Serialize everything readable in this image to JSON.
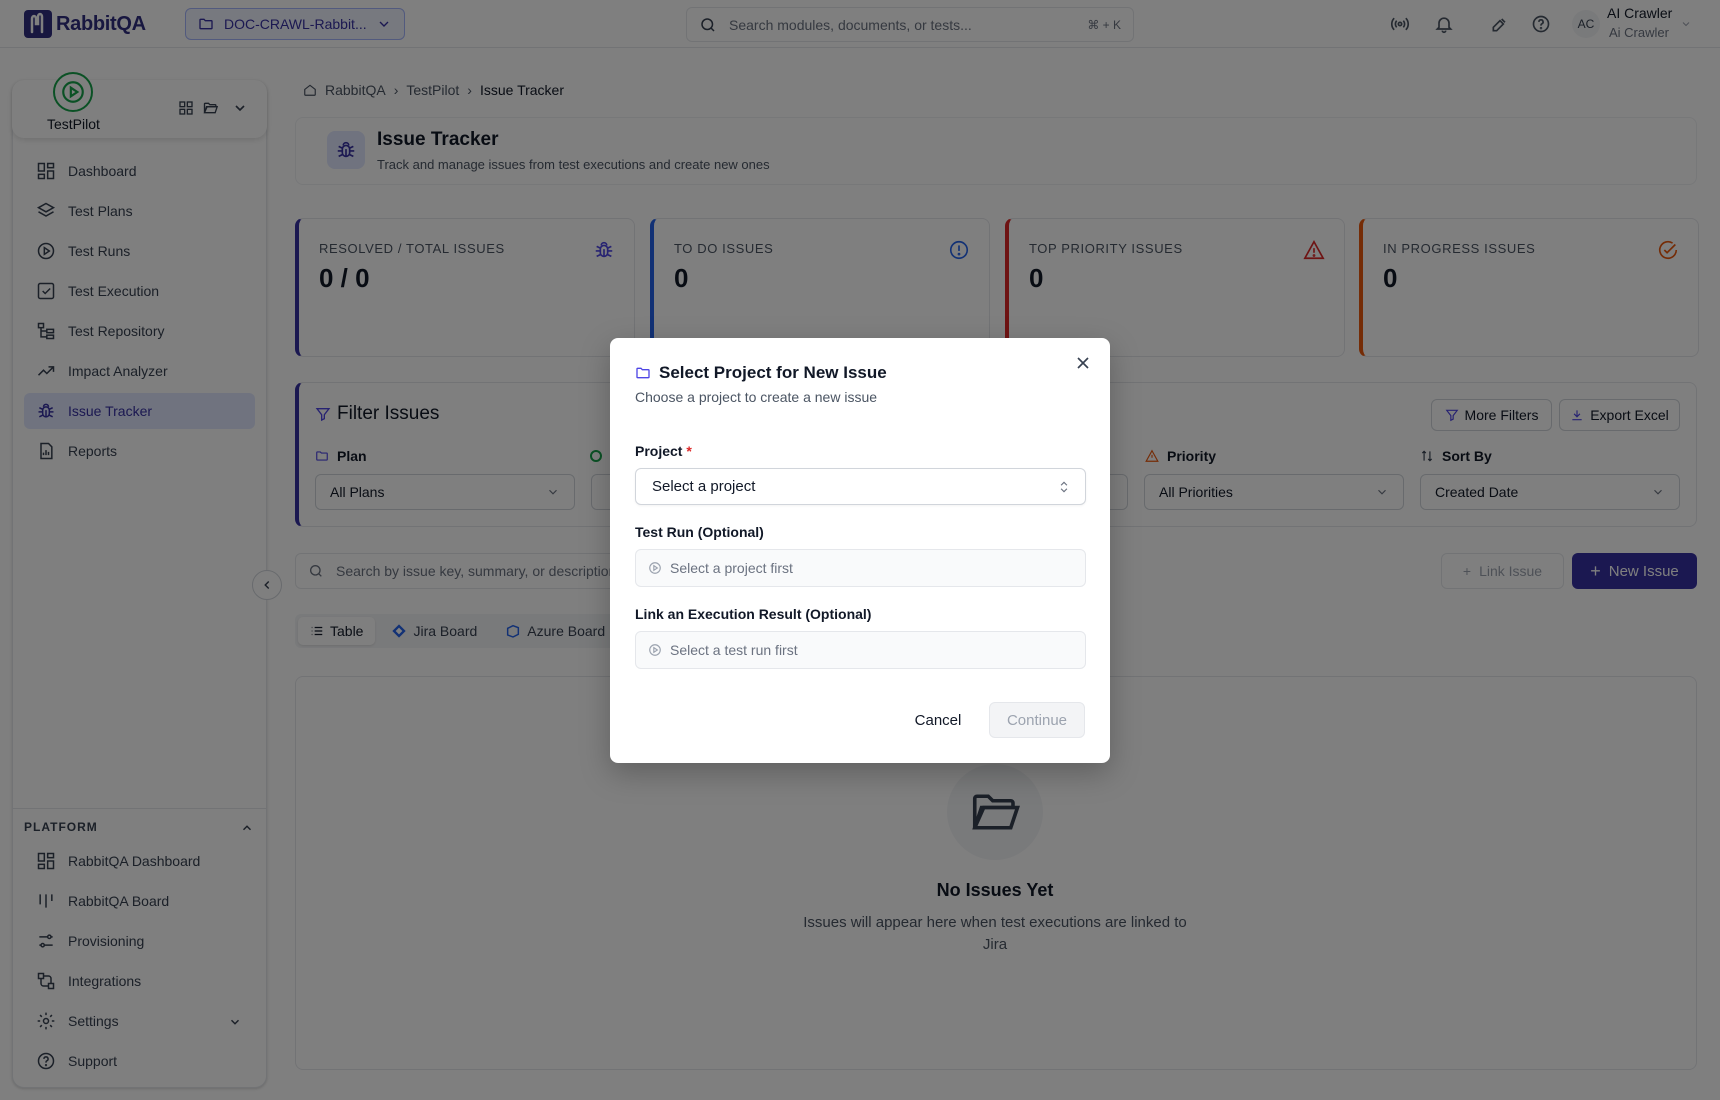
{
  "topbar": {
    "logo_text": "RabbitQA",
    "project_selector": "DOC-CRAWL-Rabbit...",
    "search_placeholder": "Search modules, documents, or tests...",
    "search_shortcut": "⌘ + K",
    "avatar_initials": "AC",
    "user_name": "AI Crawler",
    "user_sub": "Ai Crawler"
  },
  "sidebar": {
    "app_name": "TestPilot",
    "items": [
      {
        "label": "Dashboard",
        "icon": "dashboard-icon"
      },
      {
        "label": "Test Plans",
        "icon": "layers-icon"
      },
      {
        "label": "Test Runs",
        "icon": "play-circle-icon"
      },
      {
        "label": "Test Execution",
        "icon": "check-square-icon"
      },
      {
        "label": "Test Repository",
        "icon": "tree-icon"
      },
      {
        "label": "Impact Analyzer",
        "icon": "trend-icon"
      },
      {
        "label": "Issue Tracker",
        "icon": "bug-icon",
        "active": true
      },
      {
        "label": "Reports",
        "icon": "report-icon"
      }
    ],
    "platform_label": "PLATFORM",
    "platform_items": [
      {
        "label": "RabbitQA Dashboard",
        "icon": "dashboard-icon"
      },
      {
        "label": "RabbitQA Board",
        "icon": "board-icon"
      },
      {
        "label": "Provisioning",
        "icon": "sliders-icon"
      },
      {
        "label": "Integrations",
        "icon": "integrations-icon"
      },
      {
        "label": "Settings",
        "icon": "gear-icon"
      },
      {
        "label": "Support",
        "icon": "help-icon"
      }
    ]
  },
  "breadcrumb": [
    "RabbitQA",
    "TestPilot",
    "Issue Tracker"
  ],
  "header": {
    "title": "Issue Tracker",
    "subtitle": "Track and manage issues from test executions and create new ones"
  },
  "stats": [
    {
      "label": "RESOLVED / TOTAL ISSUES",
      "value": "0 / 0",
      "color": "#3730a3"
    },
    {
      "label": "TO DO ISSUES",
      "value": "0",
      "color": "#2563eb"
    },
    {
      "label": "TOP PRIORITY ISSUES",
      "value": "0",
      "color": "#dc2626"
    },
    {
      "label": "IN PROGRESS ISSUES",
      "value": "0",
      "color": "#ea580c"
    }
  ],
  "filters": {
    "title": "Filter Issues",
    "more_filters": "More Filters",
    "export_excel": "Export Excel",
    "plan_label": "Plan",
    "plan_value": "All Plans",
    "priority_label": "Priority",
    "priority_value": "All Priorities",
    "sort_label": "Sort By",
    "sort_value": "Created Date"
  },
  "toolbar": {
    "search_placeholder": "Search by issue key, summary, or description",
    "link_issue": "Link Issue",
    "new_issue": "New Issue"
  },
  "tabs": [
    "Table",
    "Jira Board",
    "Azure Board"
  ],
  "empty": {
    "title": "No Issues Yet",
    "subtitle": "Issues will appear here when test executions are linked to Jira"
  },
  "modal": {
    "title": "Select Project for New Issue",
    "subtitle": "Choose a project to create a new issue",
    "project_label": "Project",
    "project_required": "*",
    "project_placeholder": "Select a project",
    "test_run_label": "Test Run (Optional)",
    "test_run_placeholder": "Select a project first",
    "exec_label": "Link an Execution Result (Optional)",
    "exec_placeholder": "Select a test run first",
    "cancel": "Cancel",
    "continue": "Continue"
  }
}
